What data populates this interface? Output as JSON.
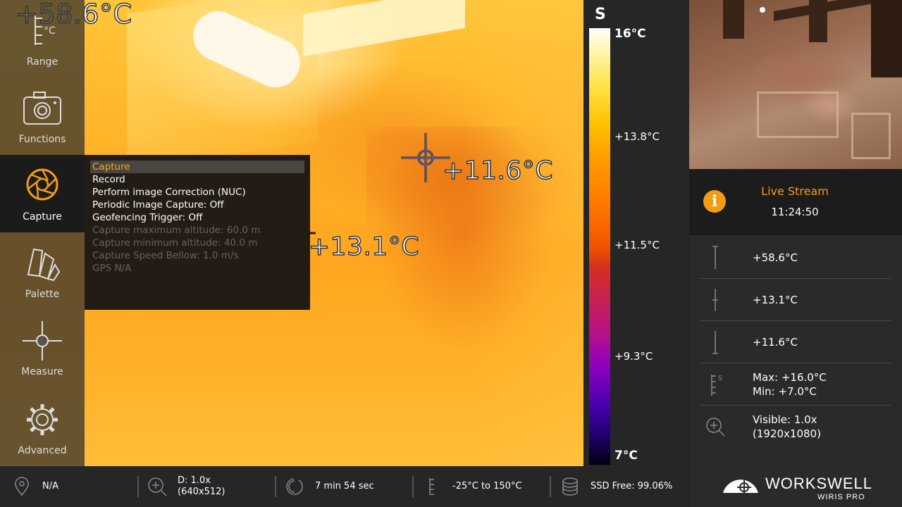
{
  "thermal": {
    "corner_temp": "+58.6°C",
    "spot1_temp": "+11.6°C",
    "spot2_temp": "+13.1°C"
  },
  "sidebar": {
    "range_unit": "°C",
    "items": [
      {
        "label": "Range",
        "icon": "range-icon"
      },
      {
        "label": "Functions",
        "icon": "camera-icon"
      },
      {
        "label": "Capture",
        "icon": "aperture-icon"
      },
      {
        "label": "Palette",
        "icon": "palette-icon"
      },
      {
        "label": "Measure",
        "icon": "crosshair-icon"
      },
      {
        "label": "Advanced",
        "icon": "gear-icon"
      }
    ]
  },
  "capture_menu": {
    "items": [
      {
        "label": "Capture"
      },
      {
        "label": "Record"
      },
      {
        "label": "Perform image Correction (NUC)"
      },
      {
        "label": "Periodic Image Capture: Off"
      },
      {
        "label": "Geofencing Trigger: Off"
      },
      {
        "label": "Capture maximum altitude: 60.0 m"
      },
      {
        "label": "Capture minimum altitude: 40.0 m"
      },
      {
        "label": "Capture Speed Bellow: 1.0 m/s"
      },
      {
        "label": "GPS N/A"
      }
    ]
  },
  "scale": {
    "mode": "S",
    "top": "16°C",
    "l1": "+13.8°C",
    "l2": "+11.5°C",
    "l3": "+9.3°C",
    "bottom": "7°C"
  },
  "live": {
    "title": "Live Stream",
    "time": "11:24:50"
  },
  "readings": {
    "max_spot": "+58.6°C",
    "center_spot": "+13.1°C",
    "min_spot": "+11.6°C",
    "range_max": "Max: +16.0°C",
    "range_min": "Min: +7.0°C",
    "visible_zoom": "Visible: 1.0x",
    "visible_res": "(1920x1080)"
  },
  "bottom": {
    "gps": "N/A",
    "zoom": "D: 1.0x",
    "zoom_res": "(640x512)",
    "time_left": "7 min 54 sec",
    "range": "-25°C to 150°C",
    "ssd": "SSD Free: 99.06%"
  },
  "logo": {
    "word": "WORKSWELL",
    "sub": "WIRIS PRO"
  },
  "colors": {
    "accent": "#f39c12",
    "menu_selected_text": "#f6a91c"
  }
}
